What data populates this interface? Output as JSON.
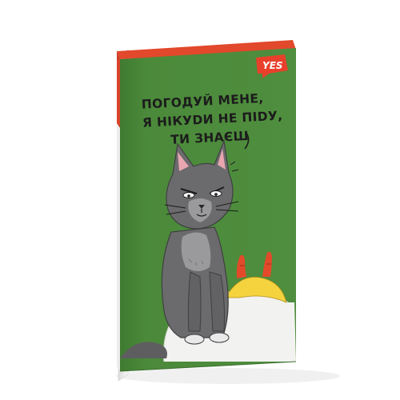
{
  "product": {
    "brand_logo": "YES",
    "caption_lines": [
      "ПОГОДУЙ МЕНЕ,",
      "Я НІКУDИ НЕ ПІDУ,",
      "ТИ ЗНАЄШ"
    ],
    "colors": {
      "cover_green": "#4b8a3a",
      "spine_orange": "#e2482b",
      "cat_grey": "#6b6b6d",
      "logo_red": "#e8402b",
      "chicken_yellow": "#f4d33f"
    }
  }
}
